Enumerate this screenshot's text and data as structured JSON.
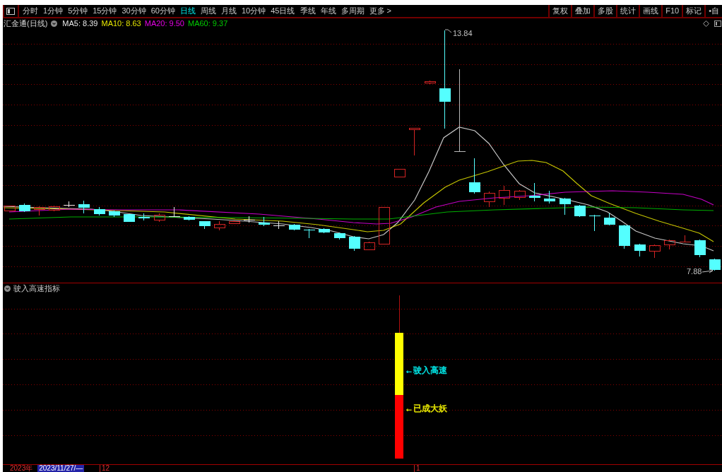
{
  "toolbar": {
    "period_tabs": [
      {
        "label": "分时",
        "selected": false
      },
      {
        "label": "1分钟",
        "selected": false
      },
      {
        "label": "5分钟",
        "selected": false
      },
      {
        "label": "15分钟",
        "selected": false
      },
      {
        "label": "30分钟",
        "selected": false
      },
      {
        "label": "60分钟",
        "selected": false
      },
      {
        "label": "日线",
        "selected": true
      },
      {
        "label": "周线",
        "selected": false
      },
      {
        "label": "月线",
        "selected": false
      },
      {
        "label": "10分钟",
        "selected": false
      },
      {
        "label": "45日线",
        "selected": false
      },
      {
        "label": "季线",
        "selected": false
      },
      {
        "label": "年线",
        "selected": false
      },
      {
        "label": "多周期",
        "selected": false
      },
      {
        "label": "更多 >",
        "selected": false
      }
    ],
    "tools": [
      "复权",
      "叠加",
      "多股",
      "统计",
      "画线",
      "F10",
      "标记",
      "•自"
    ]
  },
  "chart": {
    "title": "汇金通(日线)",
    "ma_legend": [
      {
        "label": "MA5: 8.39",
        "color": "#e8e8e8"
      },
      {
        "label": "MA10: 8.63",
        "color": "#e6e600"
      },
      {
        "label": "MA20: 9.50",
        "color": "#e600e6"
      },
      {
        "label": "MA60: 9.37",
        "color": "#00cc00"
      }
    ],
    "high_label": "13.84",
    "low_label": "7.88"
  },
  "indicator": {
    "title": "驶入高速指标",
    "signals": [
      {
        "label": "←驶入高速",
        "color": "#00e5e5"
      },
      {
        "label": "←已成大妖",
        "color": "#e6e600"
      }
    ]
  },
  "time_axis": {
    "year": "2023年",
    "cursor_date": "2023/11/27/—",
    "month_labels": [
      "12",
      "1"
    ]
  }
}
